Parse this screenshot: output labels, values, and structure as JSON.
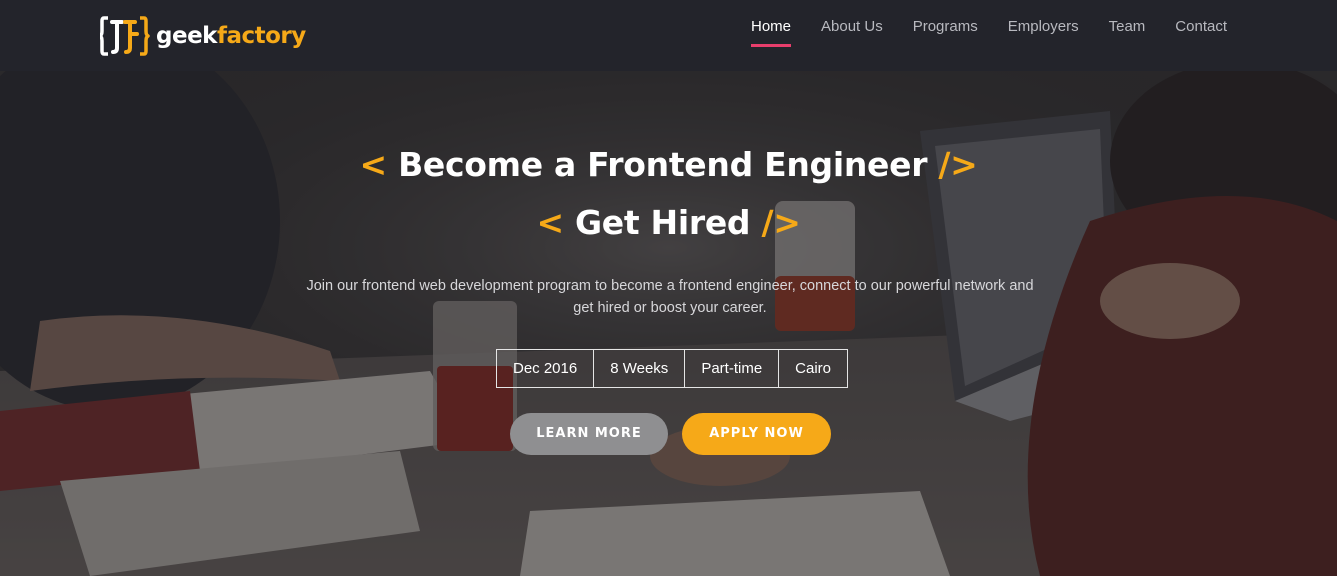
{
  "brand": {
    "name_part1": "geek",
    "name_part2": "factory",
    "logo_icon": "braces-logo-icon"
  },
  "nav": {
    "items": [
      {
        "label": "Home",
        "active": true
      },
      {
        "label": "About Us",
        "active": false
      },
      {
        "label": "Programs",
        "active": false
      },
      {
        "label": "Employers",
        "active": false
      },
      {
        "label": "Team",
        "active": false
      },
      {
        "label": "Contact",
        "active": false
      }
    ]
  },
  "hero": {
    "headline_1": "Become a Frontend Engineer",
    "headline_2": "Get Hired",
    "bracket_open": "<",
    "bracket_close": "/>",
    "subtitle": "Join our frontend web development program to become a frontend engineer, connect to our powerful network and get hired or boost your career.",
    "facts": [
      "Dec 2016",
      "8 Weeks",
      "Part-time",
      "Cairo"
    ],
    "learn_more_label": "LEARN MORE",
    "apply_now_label": "APPLY NOW"
  },
  "colors": {
    "accent": "#f6a918",
    "nav_active_underline": "#e83e6c",
    "navbar_bg": "#23242b",
    "learn_more_bg": "#8f8f91"
  }
}
